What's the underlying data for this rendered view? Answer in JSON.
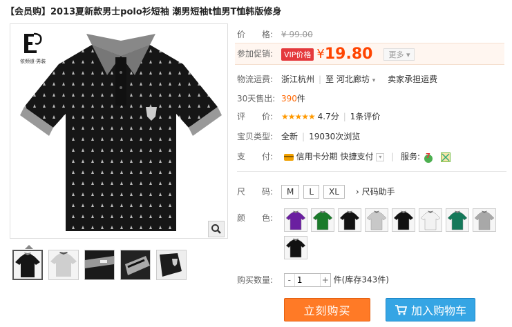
{
  "product": {
    "title": "【会员购】2013夏新款男士polo衫短袖 潮男短袖t恤男T恤韩版修身",
    "brand_logo_text": "依频道·男装"
  },
  "price": {
    "label": "价　　格:",
    "original": "¥ 99.00",
    "promo_label": "参加促销:",
    "vip_badge": "VIP价格",
    "currency": "¥",
    "amount": "19.80",
    "more_label": "更多"
  },
  "shipping": {
    "label": "物流运费:",
    "from": "浙江杭州",
    "to_prefix": "至",
    "to": "河北廊坊",
    "fee": "卖家承担运费"
  },
  "sales": {
    "label": "30天售出:",
    "count": "390",
    "unit": "件"
  },
  "rating": {
    "label": "评　　价:",
    "stars": "★★★★★",
    "score": "4.7分",
    "reviews": "1条评价"
  },
  "condition": {
    "label": "宝贝类型:",
    "type": "全新",
    "views": "19030次浏览"
  },
  "payment": {
    "label": "支　　付:",
    "credit": "信用卡分期",
    "quick": "快捷支付",
    "service_label": "服务:"
  },
  "size": {
    "label": "尺　　码:",
    "options": [
      "M",
      "L",
      "XL"
    ],
    "helper": "尺码助手"
  },
  "color": {
    "label": "颜　　色:"
  },
  "quantity": {
    "label": "购买数量:",
    "value": "1",
    "unit": "件",
    "stock": "(库存343件)"
  },
  "actions": {
    "buy_now": "立刻购买",
    "add_cart": "加入购物车"
  },
  "colors": {
    "accent": "#ff4400",
    "buy_button": "#ff7a26",
    "cart_button": "#35a5e4",
    "swatches": [
      "#6a1fa0",
      "#1a7a2a",
      "#111111",
      "#c8c8c8",
      "#111111",
      "#f2f2f2",
      "#15795a",
      "#a8a8a8",
      "#111111"
    ]
  }
}
